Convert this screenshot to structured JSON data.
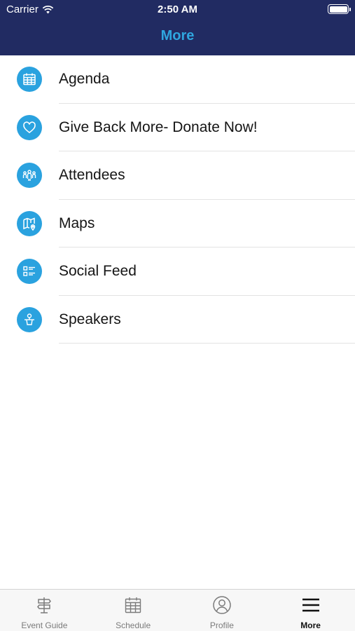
{
  "status_bar": {
    "carrier": "Carrier",
    "time": "2:50 AM"
  },
  "header": {
    "title": "More"
  },
  "colors": {
    "nav_background": "#212b62",
    "accent": "#2fa6df",
    "icon_circle": "#2aa2df"
  },
  "menu": {
    "items": [
      {
        "label": "Agenda",
        "icon": "calendar-icon"
      },
      {
        "label": "Give Back More- Donate Now!",
        "icon": "heart-icon"
      },
      {
        "label": "Attendees",
        "icon": "people-icon"
      },
      {
        "label": "Maps",
        "icon": "map-icon"
      },
      {
        "label": "Social Feed",
        "icon": "feed-list-icon"
      },
      {
        "label": "Speakers",
        "icon": "speaker-icon"
      }
    ]
  },
  "tab_bar": {
    "active": "More",
    "tabs": [
      {
        "label": "Event Guide",
        "icon": "signpost-icon"
      },
      {
        "label": "Schedule",
        "icon": "calendar-icon"
      },
      {
        "label": "Profile",
        "icon": "profile-icon"
      },
      {
        "label": "More",
        "icon": "hamburger-menu-icon"
      }
    ]
  }
}
